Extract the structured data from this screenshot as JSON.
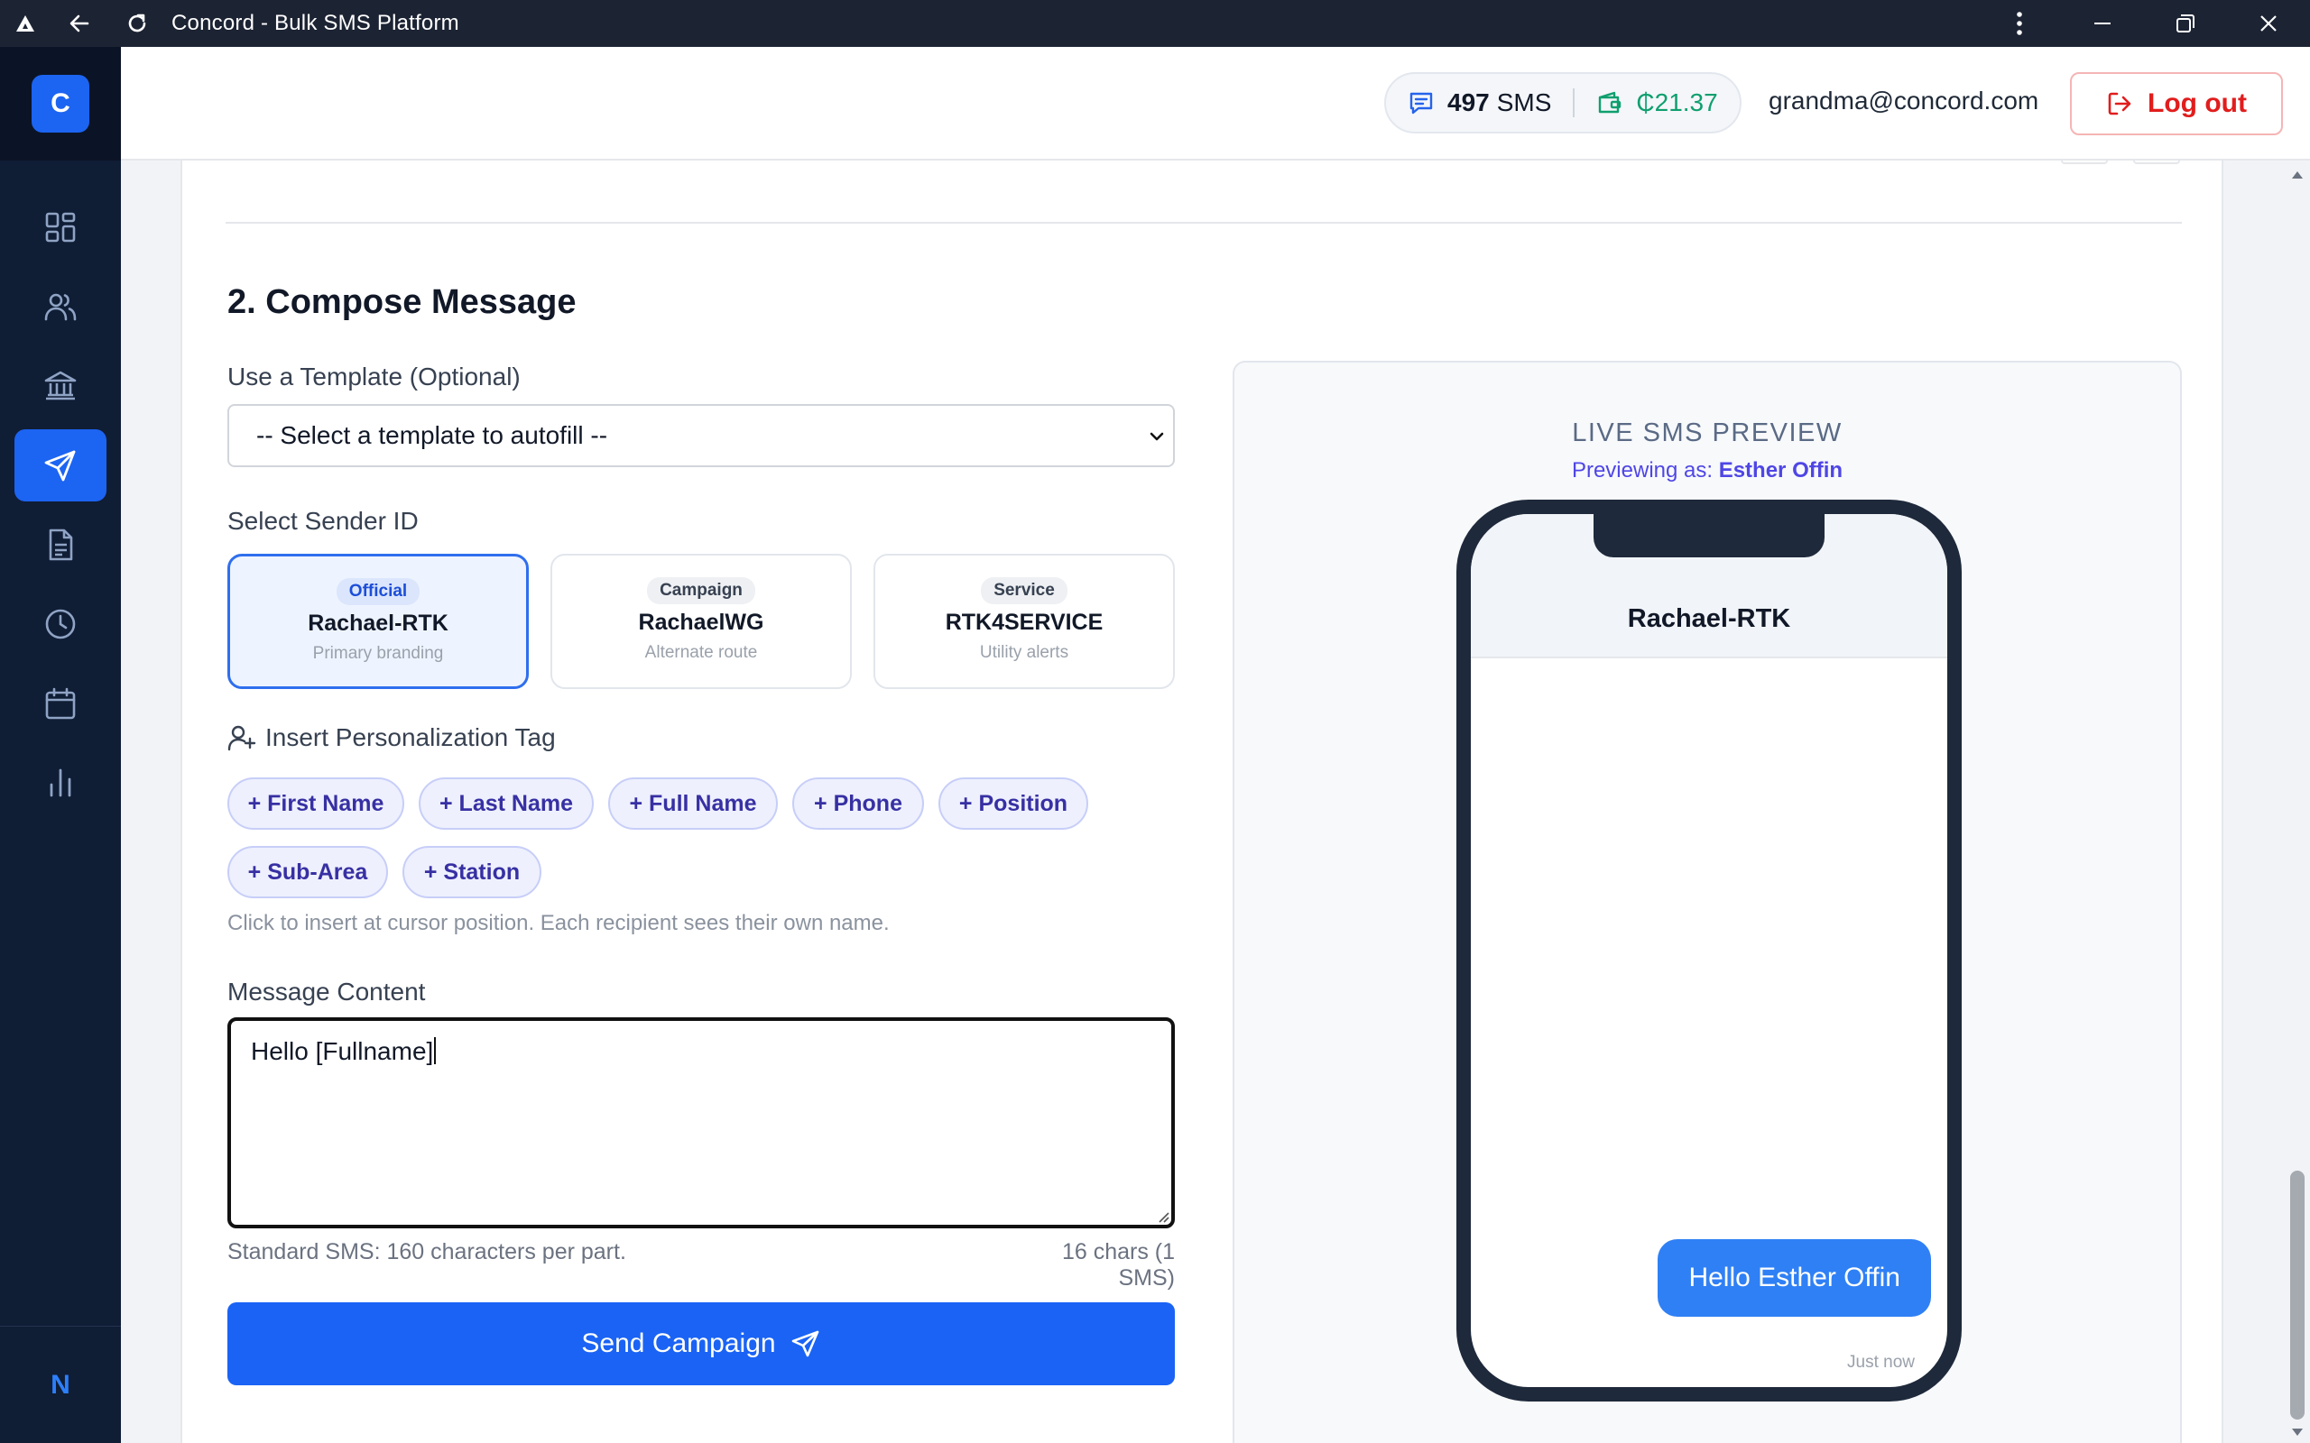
{
  "window": {
    "title": "Concord - Bulk SMS Platform"
  },
  "sidebar": {
    "logo_letter": "C",
    "items": [
      {
        "icon": "dashboard-icon",
        "active": false
      },
      {
        "icon": "users-icon",
        "active": false
      },
      {
        "icon": "bank-icon",
        "active": false
      },
      {
        "icon": "send-icon",
        "active": true
      },
      {
        "icon": "document-icon",
        "active": false
      },
      {
        "icon": "clock-icon",
        "active": false
      },
      {
        "icon": "calendar-icon",
        "active": false
      },
      {
        "icon": "bar-chart-icon",
        "active": false
      }
    ],
    "footer_letter": "N"
  },
  "header": {
    "sms_count": "497",
    "sms_unit": "SMS",
    "balance": "₵21.37",
    "user_email": "grandma@concord.com",
    "logout_label": "Log out"
  },
  "compose": {
    "section_title": "2. Compose Message",
    "template_label": "Use a Template (Optional)",
    "template_selected": "-- Select a template to autofill --",
    "sender_label": "Select Sender ID",
    "senders": [
      {
        "badge": "Official",
        "name": "Rachael-RTK",
        "sub": "Primary branding",
        "selected": true
      },
      {
        "badge": "Campaign",
        "name": "RachaelWG",
        "sub": "Alternate route",
        "selected": false
      },
      {
        "badge": "Service",
        "name": "RTK4SERVICE",
        "sub": "Utility alerts",
        "selected": false
      }
    ],
    "tag_label": "Insert Personalization Tag",
    "tags": [
      "+ First Name",
      "+ Last Name",
      "+ Full Name",
      "+ Phone",
      "+ Position",
      "+ Sub-Area",
      "+ Station"
    ],
    "tag_hint": "Click to insert at cursor position. Each recipient sees their own name.",
    "message_label": "Message Content",
    "message_value": "Hello [Fullname]",
    "sms_info": "Standard SMS: 160 characters per part.",
    "char_count": "16 chars (1 SMS)",
    "send_label": "Send Campaign"
  },
  "preview": {
    "heading": "LIVE SMS PREVIEW",
    "previewing_prefix": "Previewing as:",
    "previewing_name": "Esther Offin",
    "sender_name": "Rachael-RTK",
    "bubble_text": "Hello Esther Offin",
    "timestamp": "Just now"
  },
  "colors": {
    "accent": "#1c64f2",
    "sidebar_bg": "#0f1d35",
    "danger": "#e11d1d",
    "balance": "#0f9f6e",
    "tag_text": "#3730a3"
  }
}
